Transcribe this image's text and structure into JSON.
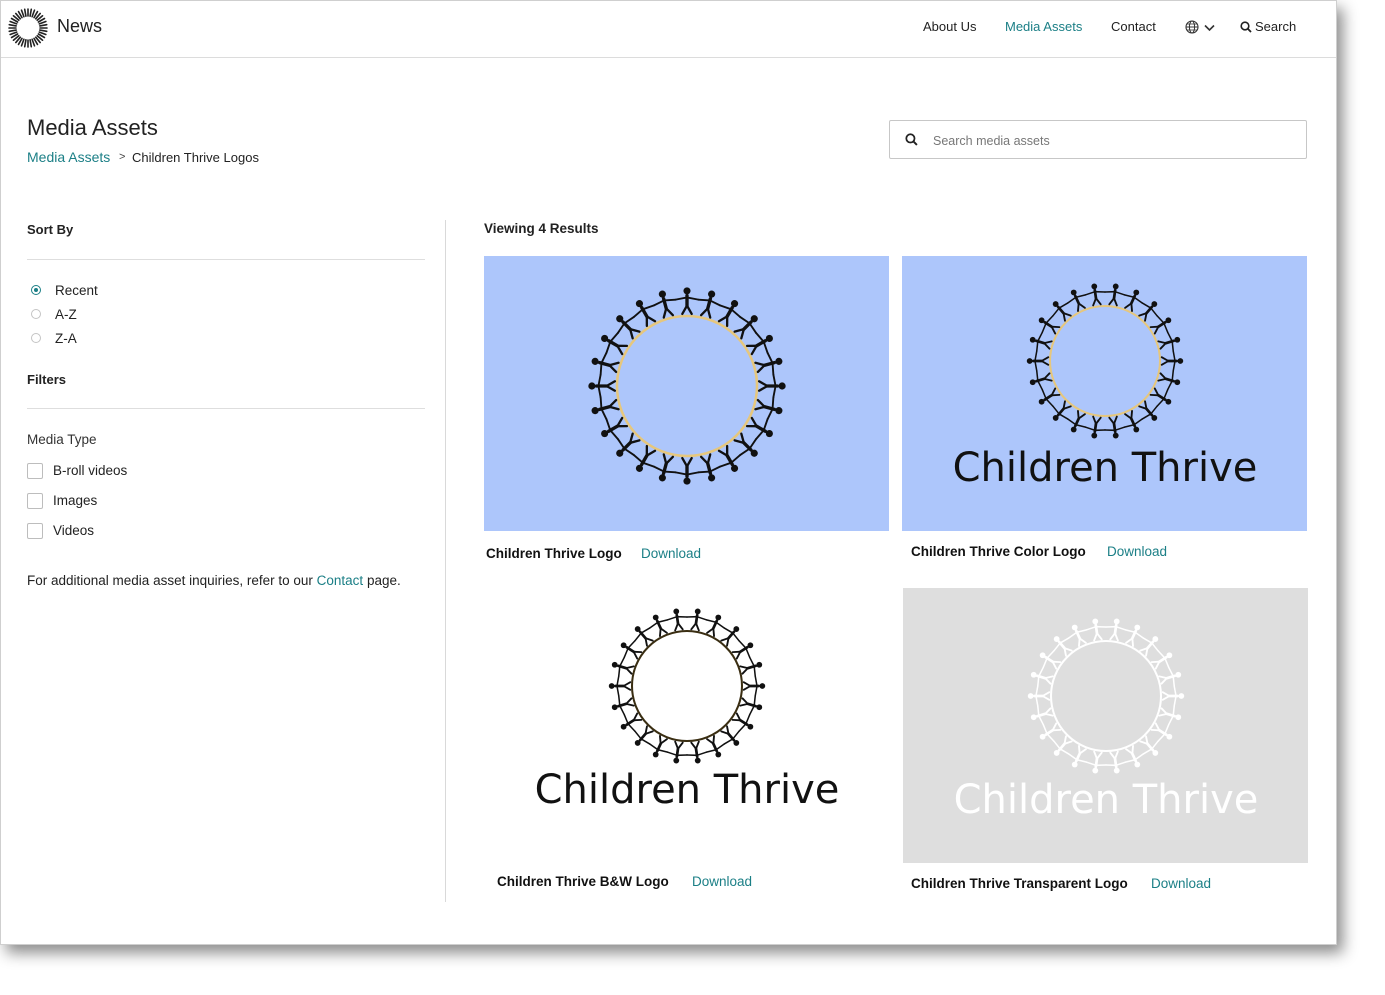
{
  "header": {
    "brand": "News",
    "nav": [
      "About Us",
      "Media Assets",
      "Contact"
    ],
    "active_nav": "Media Assets",
    "search_label": "Search"
  },
  "page": {
    "title": "Media Assets",
    "breadcrumb_link": "Media Assets",
    "breadcrumb_separator": ">",
    "breadcrumb_current": "Children Thrive Logos"
  },
  "search": {
    "placeholder": "Search media assets",
    "value": ""
  },
  "sidebar": {
    "sort_heading": "Sort By",
    "sort_options": [
      "Recent",
      "A-Z",
      "Z-A"
    ],
    "sort_selected": "Recent",
    "filters_heading": "Filters",
    "media_type_label": "Media Type",
    "media_types": [
      "B-roll videos",
      "Images",
      "Videos"
    ],
    "note_prefix": "For additional media asset inquiries, refer to our ",
    "note_link": "Contact",
    "note_suffix": " page."
  },
  "results": {
    "count_label": "Viewing 4 Results",
    "download_label": "Download",
    "cards": [
      {
        "title": "Children Thrive Logo",
        "logo_text": "",
        "bg": "#adc6fb",
        "figure": "#111111",
        "ring": "#e6c77d"
      },
      {
        "title": "Children Thrive Color Logo",
        "logo_text": "Children Thrive",
        "bg": "#adc6fb",
        "figure": "#111111",
        "ring": "#e6c77d"
      },
      {
        "title": "Children Thrive B&W Logo",
        "logo_text": "Children Thrive",
        "bg": "#ffffff",
        "figure": "#111111",
        "ring": "#3a2e12"
      },
      {
        "title": "Children Thrive Transparent Logo",
        "logo_text": "Children Thrive",
        "bg": "#dedede",
        "figure": "#ffffff",
        "ring": "#ffffff"
      }
    ]
  },
  "colors": {
    "accent": "#1b7f86",
    "text": "#222222"
  },
  "icons": [
    "sunburst-logo-icon",
    "globe-icon",
    "chevron-down-icon",
    "search-icon",
    "people-ring-icon"
  ]
}
